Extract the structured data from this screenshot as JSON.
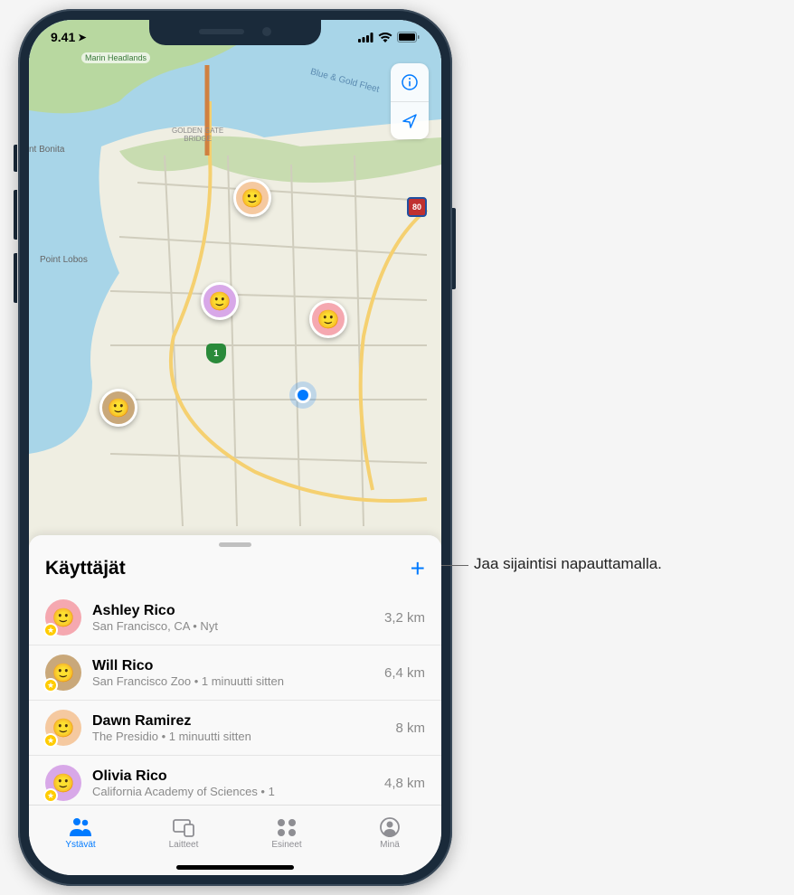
{
  "status_bar": {
    "time": "9.41",
    "location_arrow": "↗"
  },
  "map": {
    "controls": {
      "info": "i",
      "location": "➤"
    },
    "labels": {
      "marin_headlands": "Marin Headlands",
      "point_bonita": "nt Bonita",
      "point_lobos": "Point Lobos",
      "golden_gate": "GOLDEN GATE\nBRIDGE",
      "blue_gold": "Blue & Gold Fleet"
    },
    "route_1": "1",
    "route_80": "80",
    "pins": [
      {
        "color": "#f5c9a0"
      },
      {
        "color": "#d8a8e8"
      },
      {
        "color": "#f5a8b0"
      },
      {
        "color": "#c9a87a"
      }
    ]
  },
  "panel": {
    "title": "Käyttäjät",
    "plus": "+"
  },
  "people": [
    {
      "name": "Ashley Rico",
      "sub": "San Francisco, CA • Nyt",
      "dist": "3,2 km",
      "avatar_bg": "#f5a8b0",
      "fav": true
    },
    {
      "name": "Will Rico",
      "sub": "San Francisco Zoo • 1 minuutti sitten",
      "dist": "6,4 km",
      "avatar_bg": "#c9a87a",
      "fav": true
    },
    {
      "name": "Dawn Ramirez",
      "sub": "The Presidio • 1 minuutti sitten",
      "dist": "8 km",
      "avatar_bg": "#f5c9a0",
      "fav": true
    },
    {
      "name": "Olivia Rico",
      "sub": "California Academy of Sciences • 1",
      "dist": "4,8 km",
      "avatar_bg": "#d8a8e8",
      "fav": true
    }
  ],
  "tabs": [
    {
      "label": "Ystävät",
      "active": true
    },
    {
      "label": "Laitteet",
      "active": false
    },
    {
      "label": "Esineet",
      "active": false
    },
    {
      "label": "Minä",
      "active": false
    }
  ],
  "callout": {
    "text": "Jaa sijaintisi napauttamalla."
  }
}
